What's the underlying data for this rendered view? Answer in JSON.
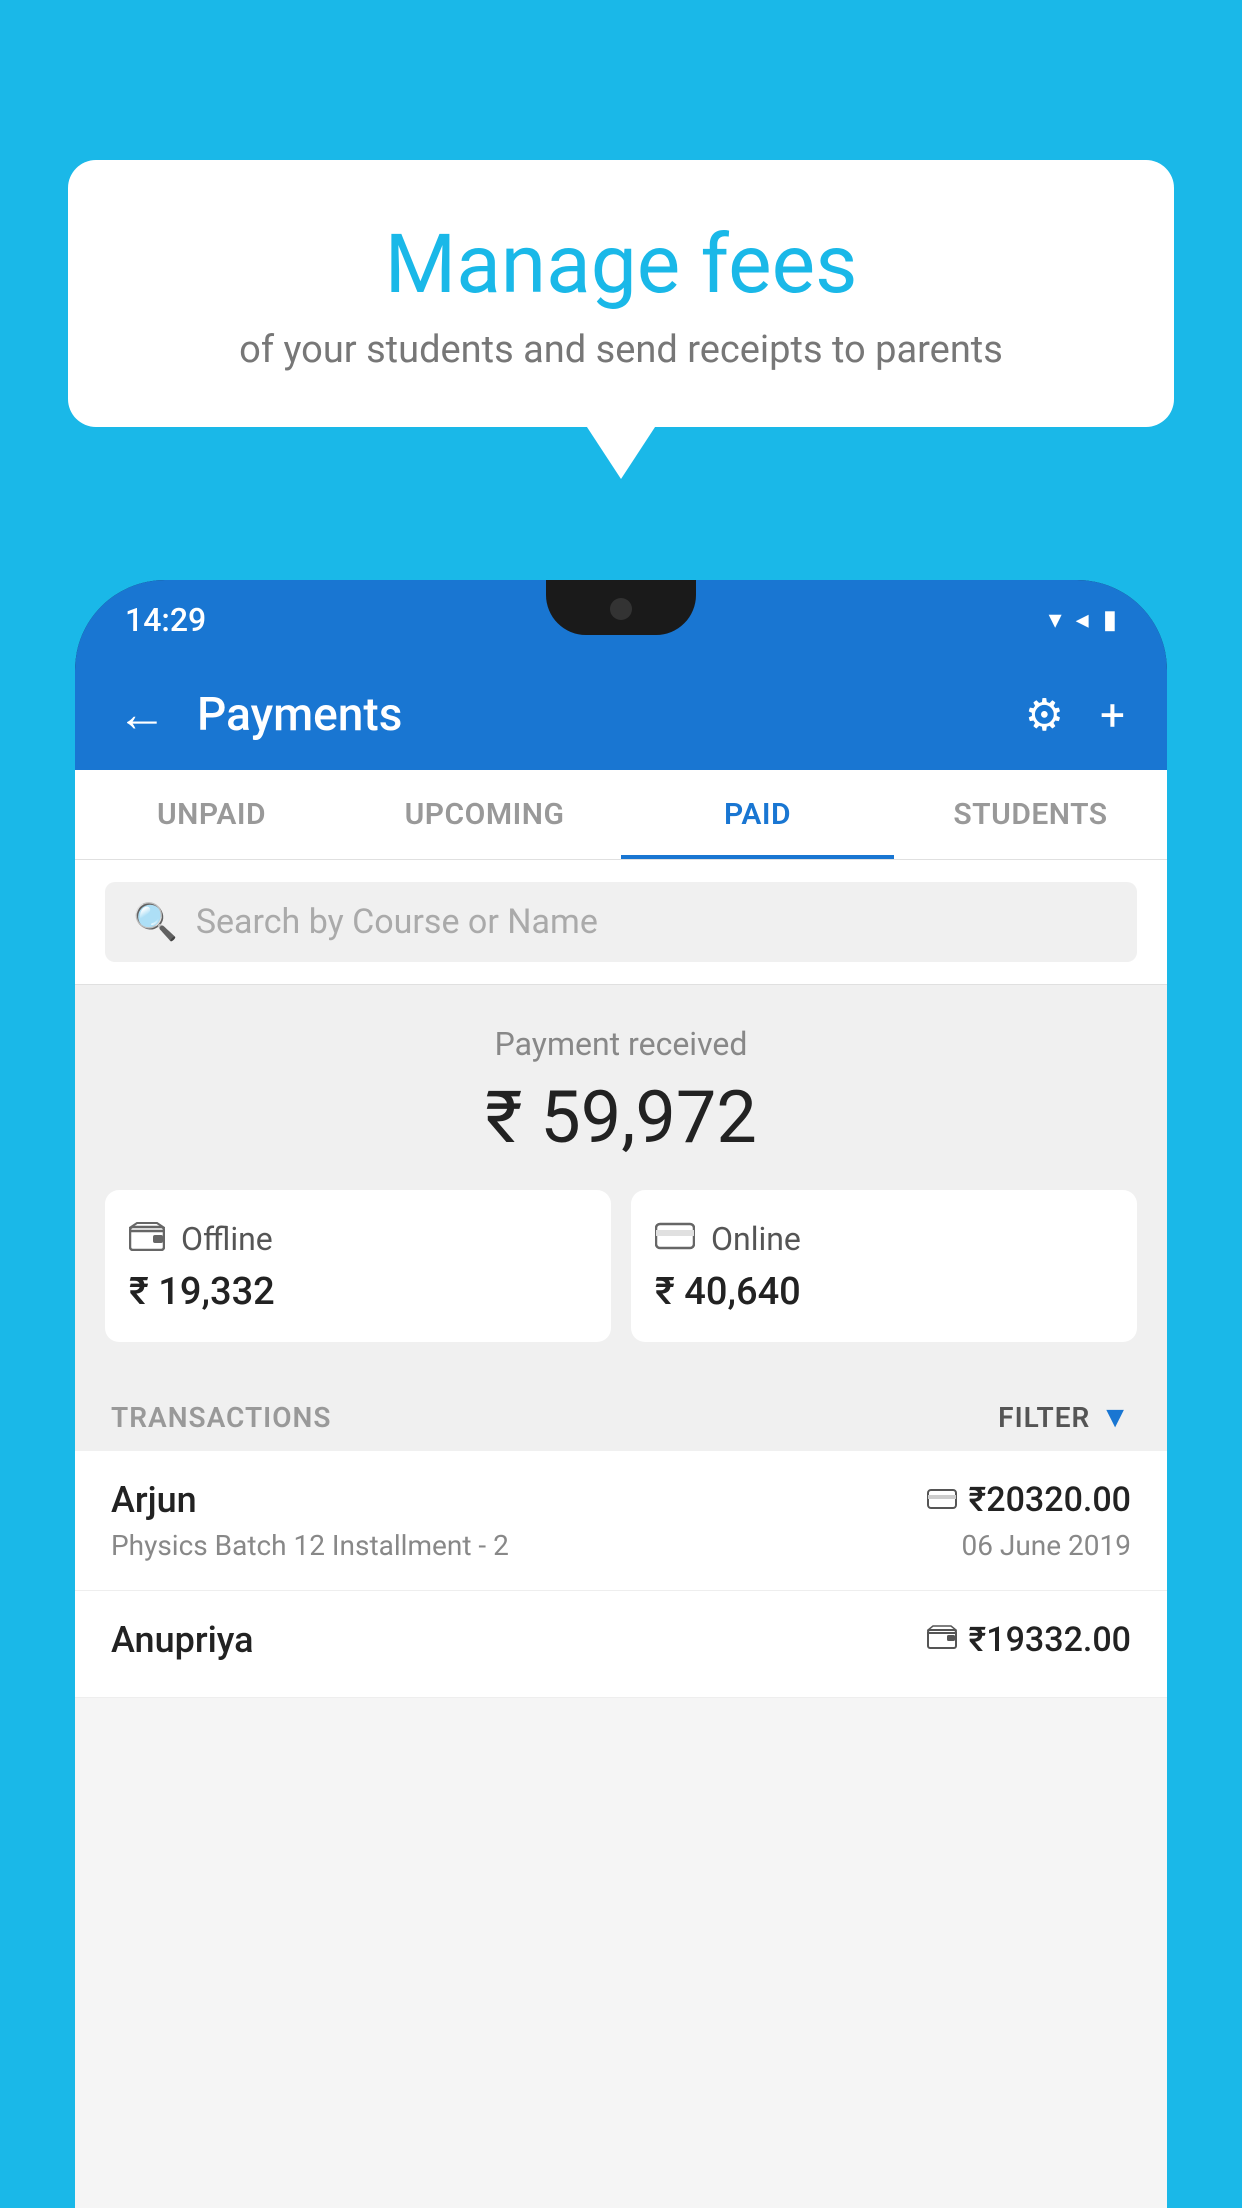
{
  "background_color": "#1ab8e8",
  "bubble": {
    "title": "Manage fees",
    "subtitle": "of your students and send receipts to parents"
  },
  "status_bar": {
    "time": "14:29",
    "icons": [
      "▼",
      "◀",
      "▉"
    ]
  },
  "header": {
    "title": "Payments",
    "back_label": "←",
    "settings_label": "⚙",
    "add_label": "+"
  },
  "tabs": [
    {
      "label": "UNPAID",
      "active": false
    },
    {
      "label": "UPCOMING",
      "active": false
    },
    {
      "label": "PAID",
      "active": true
    },
    {
      "label": "STUDENTS",
      "active": false
    }
  ],
  "search": {
    "placeholder": "Search by Course or Name"
  },
  "payment_summary": {
    "received_label": "Payment received",
    "total_amount": "₹ 59,972",
    "offline": {
      "label": "Offline",
      "amount": "₹ 19,332",
      "icon": "💳"
    },
    "online": {
      "label": "Online",
      "amount": "₹ 40,640",
      "icon": "🏦"
    }
  },
  "transactions": {
    "label": "TRANSACTIONS",
    "filter_label": "FILTER",
    "items": [
      {
        "name": "Arjun",
        "course": "Physics Batch 12 Installment - 2",
        "amount": "₹20320.00",
        "date": "06 June 2019",
        "payment_type": "online"
      },
      {
        "name": "Anupriya",
        "course": "",
        "amount": "₹19332.00",
        "date": "",
        "payment_type": "offline"
      }
    ]
  }
}
